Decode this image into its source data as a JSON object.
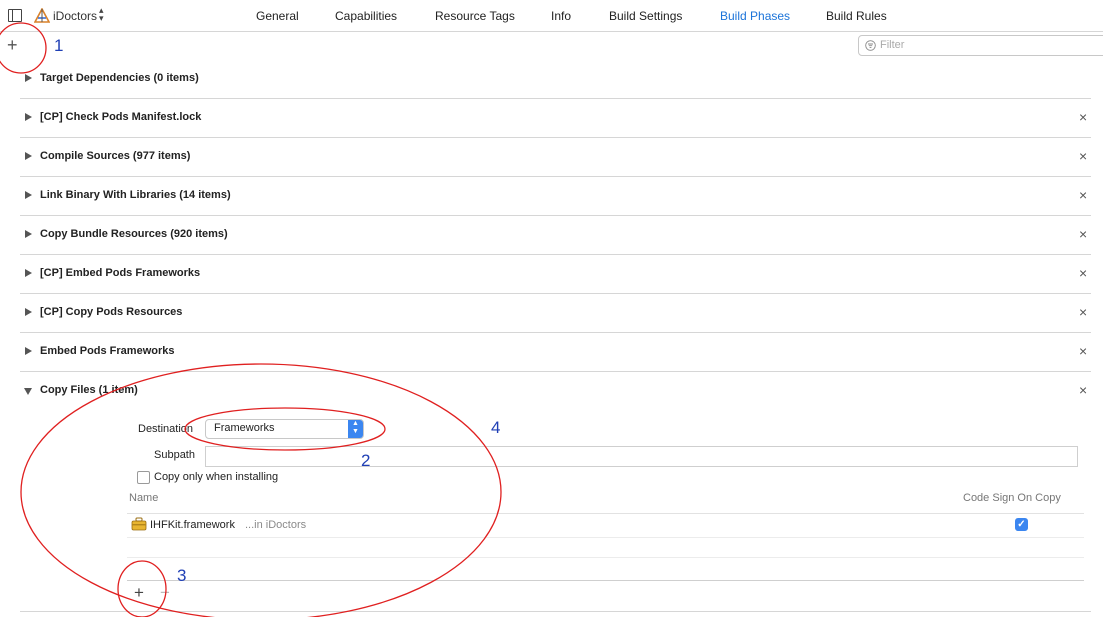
{
  "header": {
    "target_name": "iDoctors",
    "tabs": [
      {
        "label": "General",
        "active": false
      },
      {
        "label": "Capabilities",
        "active": false
      },
      {
        "label": "Resource Tags",
        "active": false
      },
      {
        "label": "Info",
        "active": false
      },
      {
        "label": "Build Settings",
        "active": false
      },
      {
        "label": "Build Phases",
        "active": true
      },
      {
        "label": "Build Rules",
        "active": false
      }
    ],
    "active_color": "#1a73d9"
  },
  "toolbar": {
    "add_symbol": "+",
    "filter_placeholder": "Filter"
  },
  "phases": [
    {
      "title": "Target Dependencies (0 items)",
      "removable": false
    },
    {
      "title": "[CP] Check Pods Manifest.lock",
      "removable": true
    },
    {
      "title": "Compile Sources (977 items)",
      "removable": true
    },
    {
      "title": "Link Binary With Libraries (14 items)",
      "removable": true
    },
    {
      "title": "Copy Bundle Resources (920 items)",
      "removable": true
    },
    {
      "title": "[CP] Embed Pods Frameworks",
      "removable": true
    },
    {
      "title": "[CP] Copy Pods Resources",
      "removable": true
    },
    {
      "title": "Embed Pods Frameworks",
      "removable": true
    },
    {
      "title": "Copy Files (1 item)",
      "removable": true,
      "expanded": true
    }
  ],
  "copy_files": {
    "destination_label": "Destination",
    "destination_value": "Frameworks",
    "subpath_label": "Subpath",
    "subpath_value": "",
    "copy_only_label": "Copy only when installing",
    "copy_only_checked": false,
    "columns": {
      "name": "Name",
      "code_sign": "Code Sign On Copy"
    },
    "files": [
      {
        "name": "IHFKit.framework",
        "location": "...in iDoctors",
        "code_sign": true
      }
    ],
    "add_symbol": "+",
    "remove_symbol": "−"
  },
  "annotations": {
    "labels": [
      "1",
      "2",
      "3",
      "4"
    ],
    "circle_color": "#e02020",
    "number_color": "#1f3fb5"
  },
  "icons": {
    "close": "×",
    "checkmark": "✓",
    "chevron": "▴▾"
  }
}
